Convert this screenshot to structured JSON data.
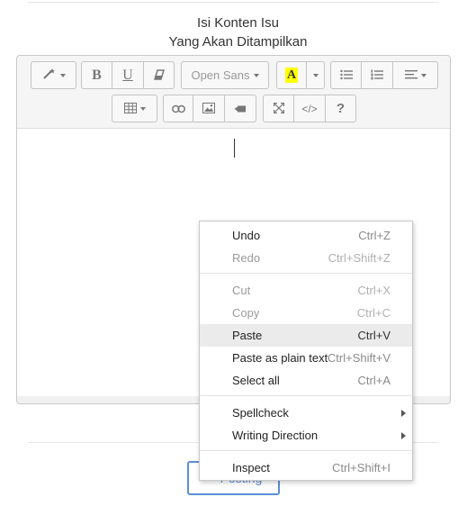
{
  "heading": {
    "line1": "Isi Konten Isu",
    "line2": "Yang Akan Ditampilkan"
  },
  "toolbar": {
    "style_icon": "magic-wand-icon",
    "bold_label": "B",
    "underline_label": "U",
    "eraser_icon": "eraser-icon",
    "font_name": "Open Sans",
    "color_label": "A",
    "color_highlight": "#ffff00",
    "ul_icon": "unordered-list-icon",
    "ol_icon": "ordered-list-icon",
    "align_icon": "align-icon",
    "table_icon": "table-icon",
    "link_icon": "link-icon",
    "picture_icon": "picture-icon",
    "video_icon": "video-icon",
    "fullscreen_icon": "fullscreen-icon",
    "code_label": "</>",
    "help_label": "?"
  },
  "posting_button": {
    "label": "Posting",
    "icon": "pencil-icon",
    "color": "#5b8fd6"
  },
  "context_menu": {
    "undo": {
      "label": "Undo",
      "shortcut": "Ctrl+Z"
    },
    "redo": {
      "label": "Redo",
      "shortcut": "Ctrl+Shift+Z"
    },
    "cut": {
      "label": "Cut",
      "shortcut": "Ctrl+X"
    },
    "copy": {
      "label": "Copy",
      "shortcut": "Ctrl+C"
    },
    "paste": {
      "label": "Paste",
      "shortcut": "Ctrl+V"
    },
    "paste_plain": {
      "label": "Paste as plain text",
      "shortcut": "Ctrl+Shift+V"
    },
    "select_all": {
      "label": "Select all",
      "shortcut": "Ctrl+A"
    },
    "spellcheck": {
      "label": "Spellcheck"
    },
    "writing_direction": {
      "label": "Writing Direction"
    },
    "inspect": {
      "label": "Inspect",
      "shortcut": "Ctrl+Shift+I"
    }
  }
}
